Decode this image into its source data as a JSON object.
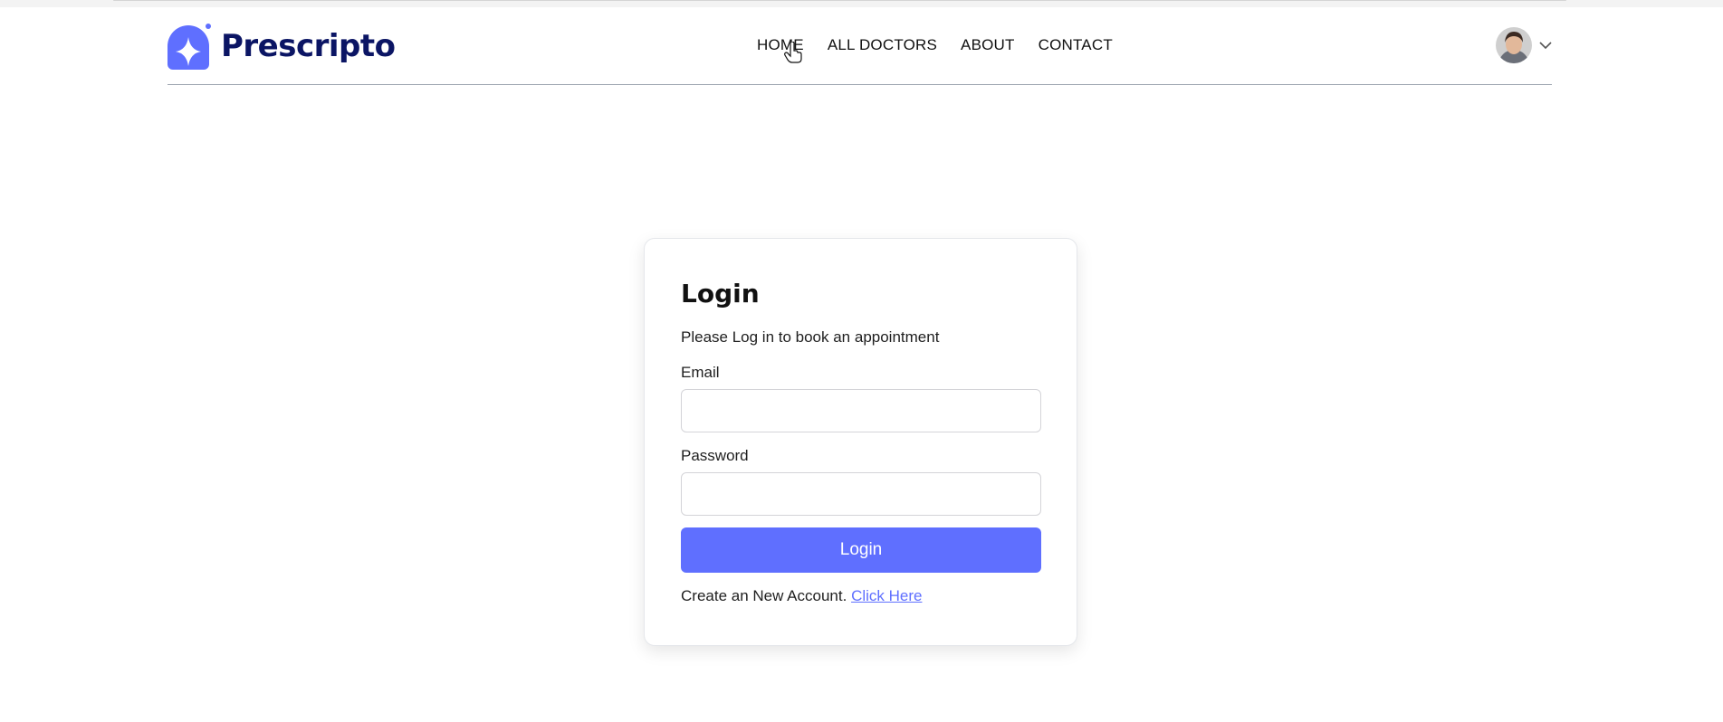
{
  "brand": {
    "name": "Prescripto",
    "logo_icon": "star-shield-logo-icon",
    "color": "#0b1564",
    "accent": "#5f6fff"
  },
  "nav": {
    "links": [
      "HOME",
      "ALL DOCTORS",
      "ABOUT",
      "CONTACT"
    ]
  },
  "user_menu": {
    "avatar_icon": "user-avatar",
    "chevron_icon": "chevron-down-icon"
  },
  "login": {
    "title": "Login",
    "subtitle": "Please Log in to book an appointment",
    "email_label": "Email",
    "email_value": "",
    "password_label": "Password",
    "password_value": "",
    "submit_label": "Login",
    "create_text": "Create an New Account.",
    "create_link": "Click Here"
  }
}
